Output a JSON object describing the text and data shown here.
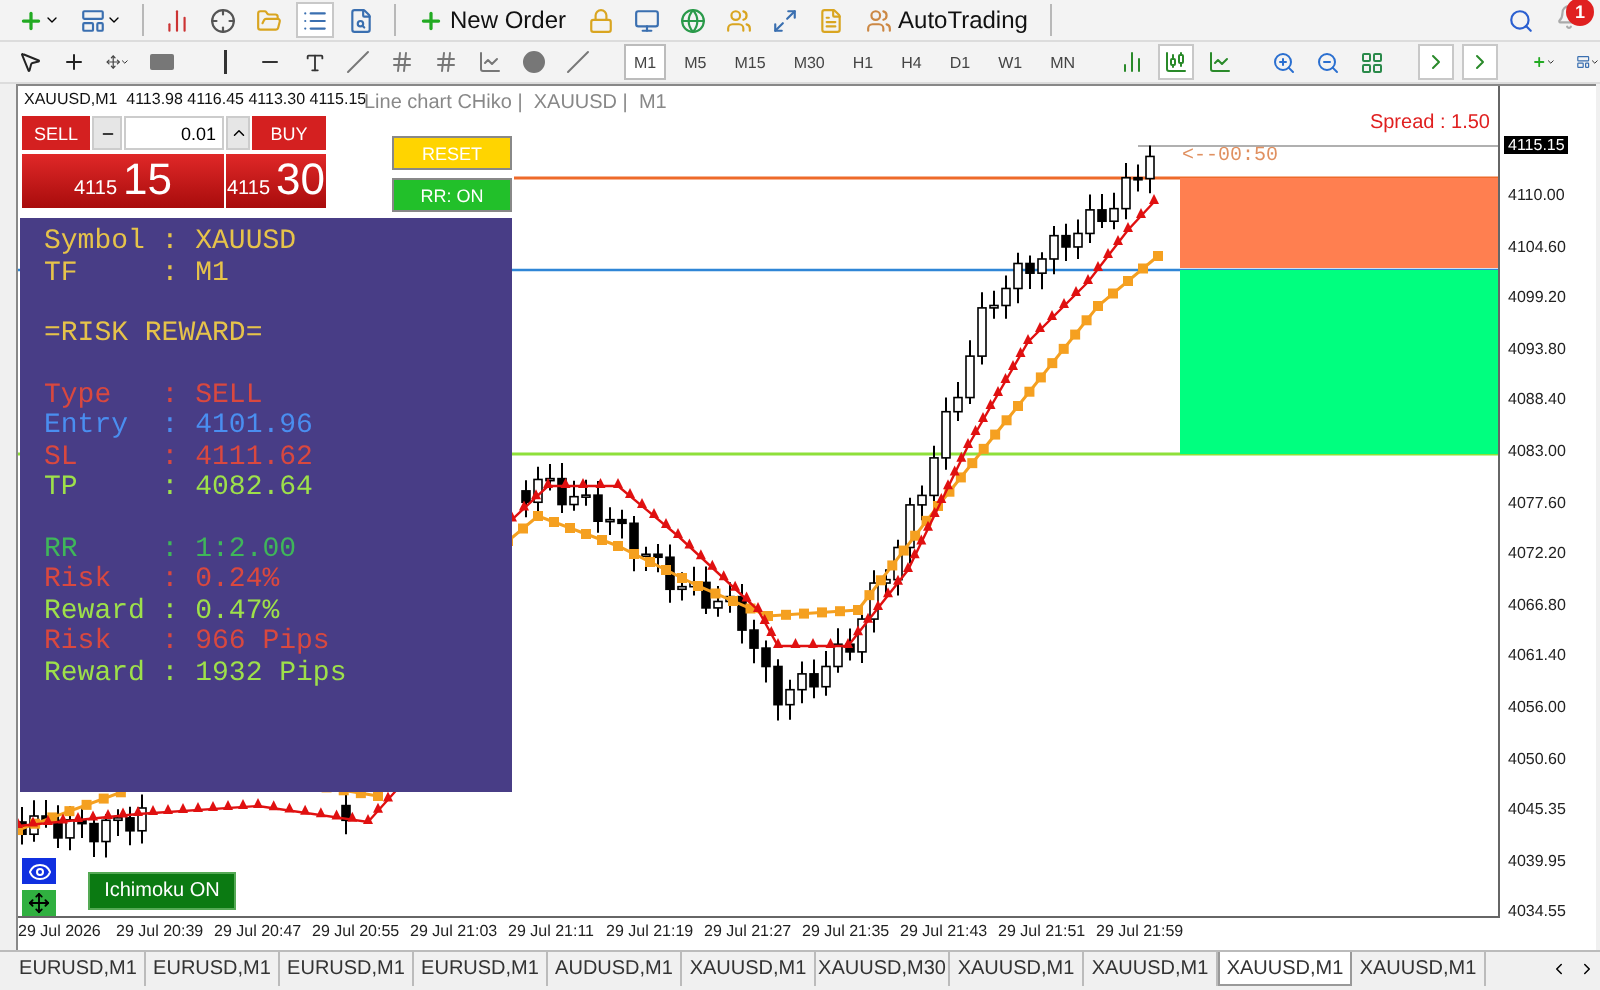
{
  "toolbar_main": {
    "new_order": "New Order",
    "autotrading": "AutoTrading",
    "notifications": "1"
  },
  "toolbar_tools": {
    "timeframes": [
      {
        "label": "M1",
        "selected": true
      },
      {
        "label": "M5",
        "selected": false
      },
      {
        "label": "M15",
        "selected": false
      },
      {
        "label": "M30",
        "selected": false
      },
      {
        "label": "H1",
        "selected": false
      },
      {
        "label": "H4",
        "selected": false
      },
      {
        "label": "D1",
        "selected": false
      },
      {
        "label": "W1",
        "selected": false
      },
      {
        "label": "MN",
        "selected": false
      }
    ]
  },
  "chart": {
    "header": "XAUUSD,M1  4113.98 4116.45 4113.30 4115.15",
    "caption": "Line chart CHiko |  XAUUSD |  M1",
    "spread": "Spread : 1.50",
    "countdown": "<--00:50",
    "current_price": "4115.15",
    "price_ticks": [
      "4110.00",
      "4104.60",
      "4099.20",
      "4093.80",
      "4088.40",
      "4083.00",
      "4077.60",
      "4072.20",
      "4066.80",
      "4061.40",
      "4056.00",
      "4050.60",
      "4045.35",
      "4039.95",
      "4034.55"
    ],
    "time_ticks": [
      "29 Jul 2026",
      "29 Jul 20:39",
      "29 Jul 20:47",
      "29 Jul 20:55",
      "29 Jul 21:03",
      "29 Jul 21:11",
      "29 Jul 21:19",
      "29 Jul 21:27",
      "29 Jul 21:35",
      "29 Jul 21:43",
      "29 Jul 21:51",
      "29 Jul 21:59"
    ]
  },
  "trade_panel": {
    "sell": "SELL",
    "buy": "BUY",
    "lot": "0.01",
    "sell_price": {
      "small": "4115",
      "big": "15"
    },
    "buy_price": {
      "small": "4115",
      "big": "30"
    }
  },
  "rr_buttons": [
    {
      "label": "RESET",
      "color": "#ffd400"
    },
    {
      "label": "RR: ON",
      "color": "#22c02a"
    }
  ],
  "info_panel": {
    "groups": [
      {
        "lines": [
          {
            "text": "Symbol : XAUUSD",
            "color": "#e6c34a"
          },
          {
            "text": "TF     : M1",
            "color": "#e6c34a"
          }
        ]
      },
      {
        "lines": [
          {
            "text": "=RISK REWARD=",
            "color": "#e6c34a"
          }
        ]
      },
      {
        "lines": [
          {
            "text": "Type   : SELL",
            "color": "#d9483f"
          },
          {
            "text": "Entry  : 4101.96",
            "color": "#4a8ef0"
          },
          {
            "text": "SL     : 4111.62",
            "color": "#d9483f"
          },
          {
            "text": "TP     : 4082.64",
            "color": "#9ee04a"
          }
        ]
      },
      {
        "lines": [
          {
            "text": "RR     : 1:2.00",
            "color": "#3fb65a"
          },
          {
            "text": "Risk   : 0.24%",
            "color": "#d9483f"
          },
          {
            "text": "Reward : 0.47%",
            "color": "#9ee04a"
          },
          {
            "text": "Risk   : 966 Pips",
            "color": "#d9483f"
          },
          {
            "text": "Reward : 1932 Pips",
            "color": "#9ee04a"
          }
        ]
      }
    ]
  },
  "ichimoku_button": "Ichimoku ON",
  "tabs": [
    {
      "label": "EURUSD,M1",
      "selected": false
    },
    {
      "label": "EURUSD,M1",
      "selected": false
    },
    {
      "label": "EURUSD,M1",
      "selected": false
    },
    {
      "label": "EURUSD,M1",
      "selected": false
    },
    {
      "label": "AUDUSD,M1",
      "selected": false
    },
    {
      "label": "XAUUSD,M1",
      "selected": false
    },
    {
      "label": "XAUUSD,M30",
      "selected": false
    },
    {
      "label": "XAUUSD,M1",
      "selected": false
    },
    {
      "label": "XAUUSD,M1",
      "selected": false
    },
    {
      "label": "XAUUSD,M1",
      "selected": true
    },
    {
      "label": "XAUUSD,M1",
      "selected": false
    }
  ]
}
